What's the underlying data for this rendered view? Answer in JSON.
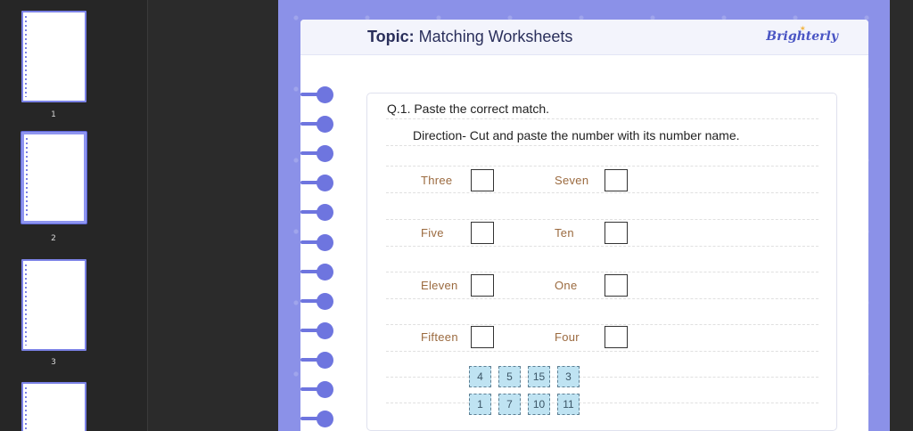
{
  "sidebar": {
    "thumbnails": [
      {
        "number": "1"
      },
      {
        "number": "2"
      },
      {
        "number": "3"
      },
      {
        "number": ""
      }
    ]
  },
  "sheet": {
    "topic_label": "Topic:",
    "topic_value": "Matching Worksheets",
    "brand": "Brighterly"
  },
  "question": {
    "title": "Q.1. Paste the correct match.",
    "direction": "Direction- Cut and paste the number with its number name.",
    "left_words": [
      "Three",
      "Five",
      "Eleven",
      "Fifteen"
    ],
    "right_words": [
      "Seven",
      "Ten",
      "One",
      "Four"
    ],
    "tiles_row1": [
      "4",
      "5",
      "15",
      "3"
    ],
    "tiles_row2": [
      "1",
      "7",
      "10",
      "11"
    ]
  },
  "colors": {
    "accent": "#8b91e8",
    "ring": "#6e75df",
    "tile": "#bfe3f2",
    "word": "#9b6a3f"
  }
}
